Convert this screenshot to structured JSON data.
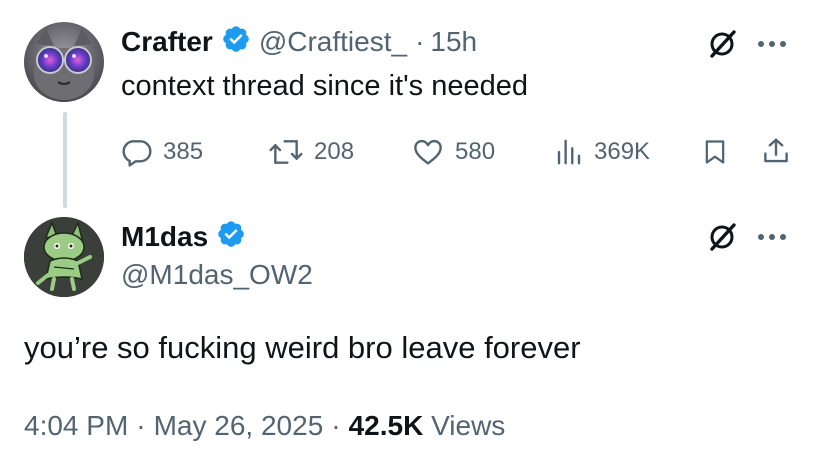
{
  "tweet1": {
    "display_name": "Crafter",
    "handle": "@Craftiest_",
    "separator": "·",
    "time": "15h",
    "text": "context thread since it's needed",
    "actions": {
      "replies": "385",
      "reposts": "208",
      "likes": "580",
      "views": "369K"
    },
    "icons": [
      "verified-badge-icon",
      "grok-icon",
      "more-icon",
      "reply-icon",
      "repost-icon",
      "like-icon",
      "views-icon",
      "bookmark-icon",
      "share-icon"
    ]
  },
  "tweet2": {
    "display_name": "M1das",
    "handle": "@M1das_OW2",
    "text": "you’re so fucking weird bro leave forever",
    "time": "4:04 PM",
    "dot1": "·",
    "date": "May 26, 2025",
    "dot2": "·",
    "views_count": "42.5K",
    "views_label": "Views",
    "icons": [
      "verified-badge-icon",
      "grok-icon",
      "more-icon"
    ]
  },
  "colors": {
    "text": "#0f1419",
    "muted": "#536471",
    "verified": "#1d9bf0",
    "thread_line": "#cfd9de"
  }
}
